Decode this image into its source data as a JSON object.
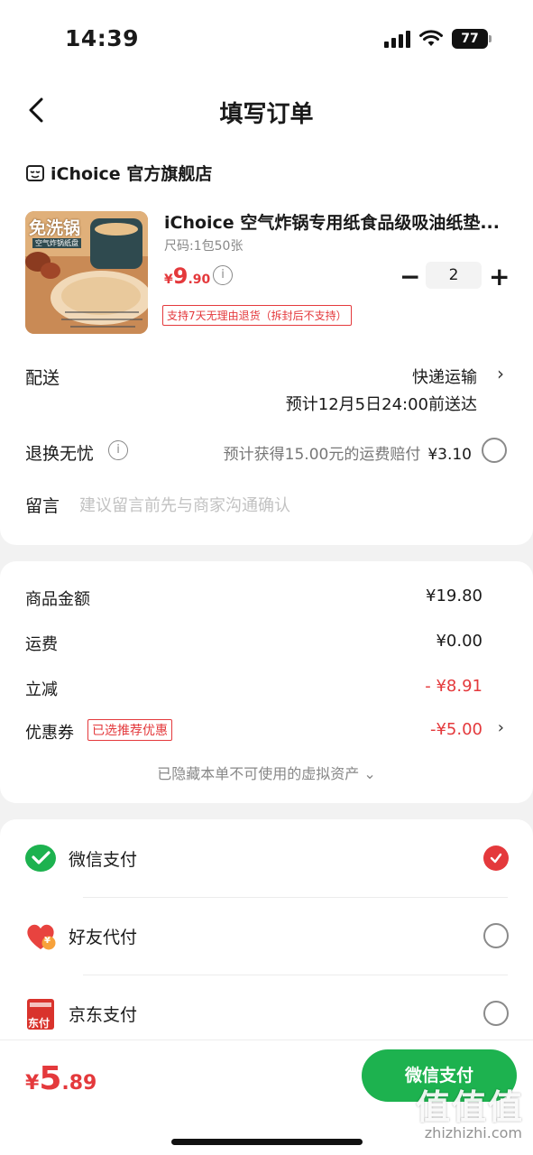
{
  "status_bar": {
    "time": "14:39",
    "battery": "77"
  },
  "nav": {
    "title": "填写订单"
  },
  "shop": {
    "name": "iChoice 官方旗舰店"
  },
  "product": {
    "title": "iChoice 空气炸锅专用纸食品级吸油纸垫...",
    "spec": "尺码:1包50张",
    "price_currency": "¥",
    "price_int": "9",
    "price_dec": ".90",
    "quantity": "2",
    "minus": "−",
    "plus": "+",
    "return_policy": "支持7天无理由退货（拆封后不支持）",
    "image_text_main": "免洗锅",
    "image_text_sub": "空气炸锅纸盘"
  },
  "delivery": {
    "label": "配送",
    "method": "快递运输",
    "estimate": "预计12月5日24:00前送达"
  },
  "exchange": {
    "label": "退换无忧",
    "desc": "预计获得15.00元的运费赔付",
    "price": "¥3.10"
  },
  "message": {
    "label": "留言",
    "placeholder": "建议留言前先与商家沟通确认"
  },
  "amounts": {
    "goods_label": "商品金额",
    "goods_value": "¥19.80",
    "shipping_label": "运费",
    "shipping_value": "¥0.00",
    "discount_label": "立减",
    "discount_value": "- ¥8.91",
    "coupon_label": "优惠券",
    "coupon_tag": "已选推荐优惠",
    "coupon_value": "-¥5.00",
    "hidden_assets": "已隐藏本单不可使用的虚拟资产 ⌄"
  },
  "payments": [
    {
      "label": "微信支付",
      "selected": true
    },
    {
      "label": "好友代付",
      "selected": false
    },
    {
      "label": "京东支付",
      "selected": false
    }
  ],
  "jd_pay_icon_text": "东付",
  "friend_pay_icon_text": "¥",
  "bottom": {
    "currency": "¥",
    "total_int": "5",
    "total_dec": ".89",
    "submit_label": "微信支付"
  },
  "watermark": {
    "text": "值值值",
    "url": "zhizhizhi.com"
  },
  "colors": {
    "accent_red": "#e4393c",
    "wechat_green": "#1db24f"
  }
}
